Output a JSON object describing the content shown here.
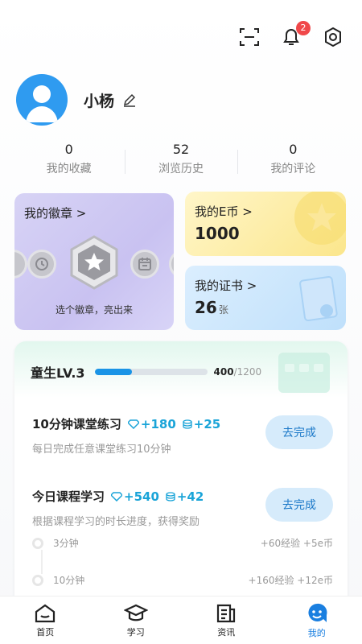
{
  "header": {
    "notification_count": "2"
  },
  "profile": {
    "name": "小杨"
  },
  "stats": [
    {
      "value": "0",
      "label": "我的收藏"
    },
    {
      "value": "52",
      "label": "浏览历史"
    },
    {
      "value": "0",
      "label": "我的评论"
    }
  ],
  "badges_card": {
    "title": "我的徽章 >",
    "hint": "选个徽章，亮出来"
  },
  "coin_card": {
    "title": "我的E币 >",
    "value": "1000"
  },
  "cert_card": {
    "title": "我的证书 >",
    "value": "26",
    "unit": "张"
  },
  "level": {
    "name": "童生LV.3",
    "current": "400",
    "total": "/1200",
    "progress": 0.333
  },
  "tasks": [
    {
      "title": "10分钟课堂练习",
      "exp": "+180",
      "coin": "+25",
      "desc": "每日完成任意课堂练习10分钟",
      "button": "去完成"
    },
    {
      "title": "今日课程学习",
      "exp": "+540",
      "coin": "+42",
      "desc": "根据课程学习的时长进度，获得奖励",
      "button": "去完成"
    }
  ],
  "steps": [
    {
      "label": "3分钟",
      "reward": "+60经验  +5e币"
    },
    {
      "label": "10分钟",
      "reward": "+160经验  +12e币"
    }
  ],
  "nav": [
    {
      "label": "首页"
    },
    {
      "label": "学习"
    },
    {
      "label": "资讯"
    },
    {
      "label": "我的"
    }
  ],
  "colors": {
    "accent": "#1a7fe0",
    "reward": "#1aa4d8",
    "badge": "#f0484a"
  }
}
